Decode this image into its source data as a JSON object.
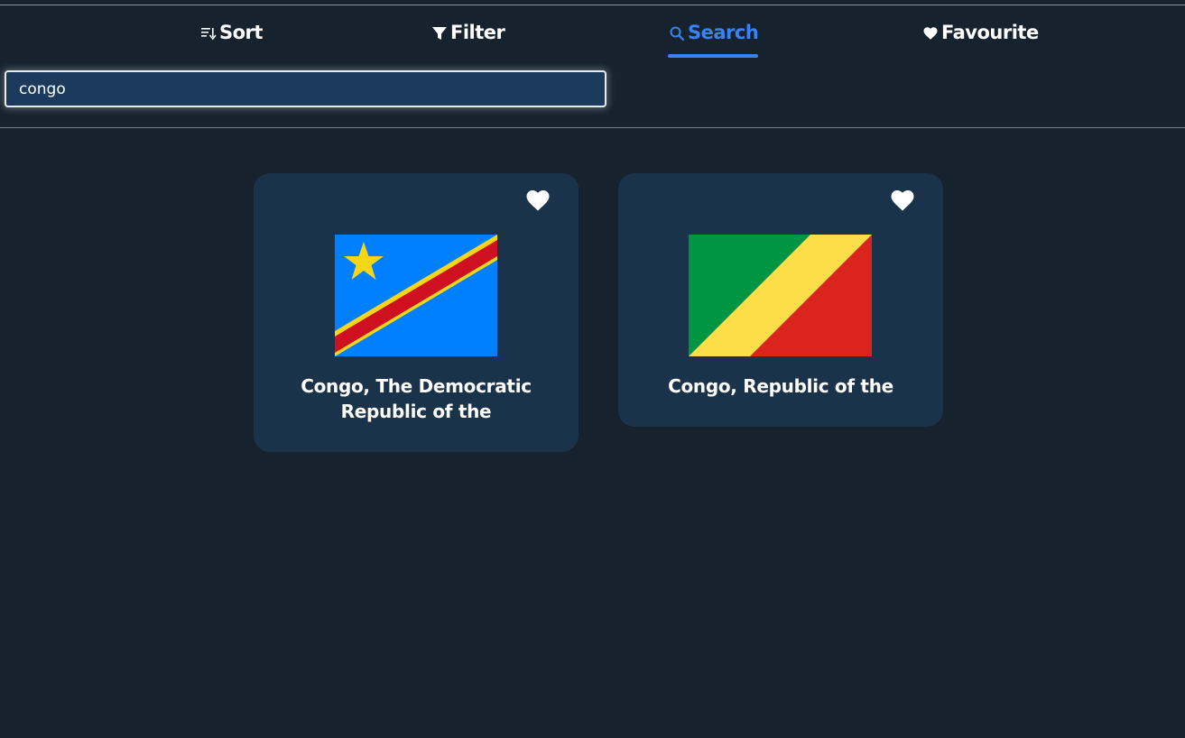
{
  "nav": {
    "tabs": [
      {
        "label": "Sort",
        "icon": "sort-icon"
      },
      {
        "label": "Filter",
        "icon": "filter-icon"
      },
      {
        "label": "Search",
        "icon": "search-icon",
        "active": true
      },
      {
        "label": "Favourite",
        "icon": "heart-icon"
      }
    ]
  },
  "search": {
    "value": "congo",
    "placeholder": ""
  },
  "results": [
    {
      "name": "Congo, The Democratic Republic of the",
      "flag": "drc-flag"
    },
    {
      "name": "Congo, Republic of the",
      "flag": "republic-of-congo-flag"
    }
  ],
  "colors": {
    "background": "#16222d",
    "card": "#1a334a",
    "accent": "#3b82f6",
    "input": "#1b3a5c"
  }
}
